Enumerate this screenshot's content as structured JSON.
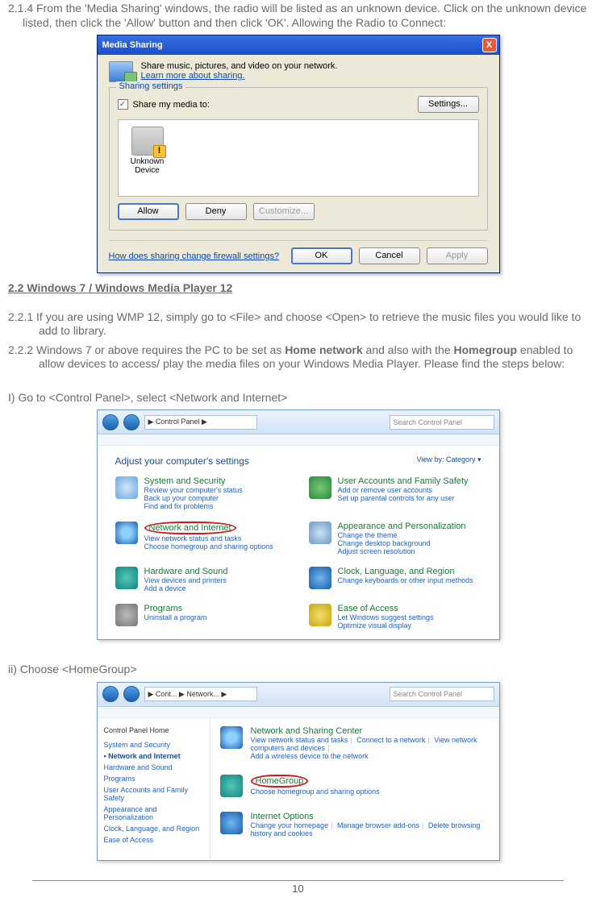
{
  "section_214": "2.1.4 From the 'Media Sharing' windows, the radio will be listed as an unknown device. Click on the unknown device listed, then click the 'Allow' button and then click 'OK'. Allowing the Radio to Connect:",
  "dlg": {
    "title": "Media Sharing",
    "close": "X",
    "blurb": "Share music, pictures, and video on your network.",
    "learn": "Learn more about sharing.",
    "legend": "Sharing settings",
    "share_chk": "Share my media to:",
    "settings": "Settings...",
    "dev": "Unknown Device",
    "allow": "Allow",
    "deny": "Deny",
    "customize": "Customize...",
    "firewall": "How does sharing change firewall settings?",
    "ok": "OK",
    "cancel": "Cancel",
    "apply": "Apply"
  },
  "hdr_22": "2.2 Windows 7 / Windows Media Player 12",
  "section_221": "2.2.1 If you are using WMP 12, simply go to <File> and choose <Open> to retrieve the music files you would like to add to library.",
  "section_222_a": "2.2.2 Windows 7 or above requires the PC to be set as ",
  "section_222_b": "Home network",
  "section_222_c": " and also with the ",
  "section_222_d": "Homegroup",
  "section_222_e": " enabled to allow devices to access/ play the media files on your Windows Media Player. Please find the steps below:",
  "step_i": "I) Go to <Control Panel>, select <Network and Internet>",
  "cp": {
    "addr": "▶  Control Panel  ▶",
    "search": "Search Control Panel",
    "hdr": "Adjust your computer's settings",
    "viewby": "View by:   Category ▾",
    "items": [
      {
        "t": "System and Security",
        "subs": [
          "Review your computer's status",
          "Back up your computer",
          "Find and fix problems"
        ]
      },
      {
        "t": "User Accounts and Family Safety",
        "subs": [
          "Add or remove user accounts",
          "Set up parental controls for any user"
        ]
      },
      {
        "t": "Network and Internet",
        "subs": [
          "View network status and tasks",
          "Choose homegroup and sharing options"
        ],
        "circled": true
      },
      {
        "t": "Appearance and Personalization",
        "subs": [
          "Change the theme",
          "Change desktop background",
          "Adjust screen resolution"
        ]
      },
      {
        "t": "Hardware and Sound",
        "subs": [
          "View devices and printers",
          "Add a device"
        ]
      },
      {
        "t": "Clock, Language, and Region",
        "subs": [
          "Change keyboards or other input methods"
        ]
      },
      {
        "t": "Programs",
        "subs": [
          "Uninstall a program"
        ]
      },
      {
        "t": "Ease of Access",
        "subs": [
          "Let Windows suggest settings",
          "Optimize visual display"
        ]
      }
    ]
  },
  "step_ii": "ii) Choose <HomeGroup>",
  "ni": {
    "addr": "▶ Cont... ▶ Network... ▶",
    "search": "Search Control Panel",
    "sidehdr": "Control Panel Home",
    "side": [
      "System and Security",
      "Network and Internet",
      "Hardware and Sound",
      "Programs",
      "User Accounts and Family Safety",
      "Appearance and Personalization",
      "Clock, Language, and Region",
      "Ease of Access"
    ],
    "m1_t": "Network and Sharing Center",
    "m1_subs": [
      "View network status and tasks",
      "Connect to a network",
      "View network computers and devices",
      "Add a wireless device to the network"
    ],
    "m2_t": "HomeGroup",
    "m2_sub": "Choose homegroup and sharing options",
    "m3_t": "Internet Options",
    "m3_subs": [
      "Change your homepage",
      "Manage browser add-ons",
      "Delete browsing history and cookies"
    ]
  },
  "pagenum": "10"
}
